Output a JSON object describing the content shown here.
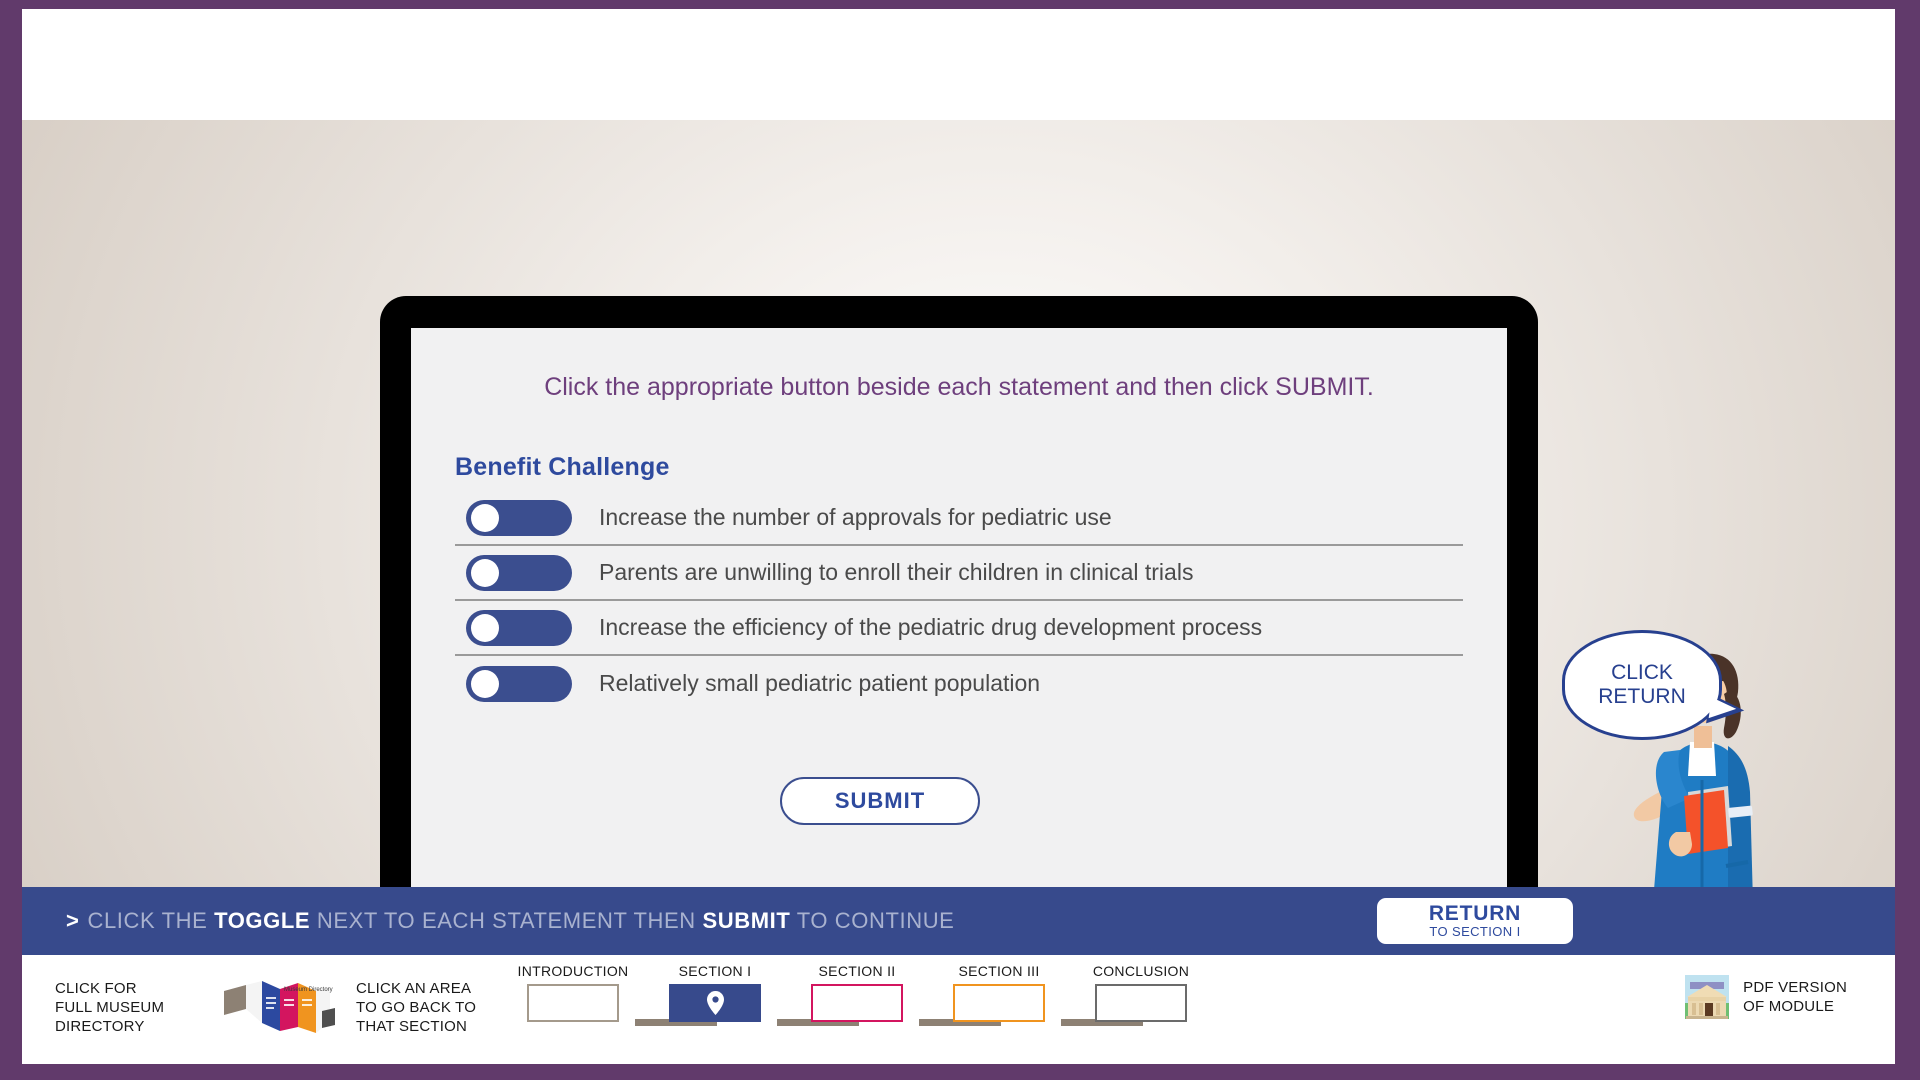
{
  "theme": {
    "frame_purple": "#613A6B",
    "bar_blue": "#374A8C",
    "toggle_blue": "#3B4E8F",
    "heading_blue": "#2E4A9E",
    "prompt_purple": "#6E3F7D",
    "scene_beige": "#B5A99D",
    "connector_brown": "#8D8174"
  },
  "screen": {
    "prompt": "Click the appropriate button beside each statement and then click SUBMIT.",
    "heading": "Benefit Challenge",
    "statements": [
      {
        "text": "Increase the number of approvals for pediatric use",
        "toggle_state": "left"
      },
      {
        "text": "Parents are unwilling to enroll their children in clinical trials",
        "toggle_state": "left"
      },
      {
        "text": "Increase the efficiency of the pediatric drug development process",
        "toggle_state": "left"
      },
      {
        "text": "Relatively small pediatric patient population",
        "toggle_state": "left"
      }
    ],
    "submit_label": "SUBMIT"
  },
  "presenter": {
    "bubble_line1": "CLICK",
    "bubble_line2": "RETURN"
  },
  "instruction_bar": {
    "chevron": ">",
    "part1": "CLICK THE ",
    "highlight1": "TOGGLE",
    "part2": " NEXT TO EACH STATEMENT THEN ",
    "highlight2": "SUBMIT",
    "part3": " TO CONTINUE",
    "return_button": {
      "line1": "RETURN",
      "line2": "TO SECTION I"
    }
  },
  "bottom_nav": {
    "museum_directory_label": "CLICK FOR\nFULL MUSEUM\nDIRECTORY",
    "brochure_icon_name": "museum-directory-brochure-icon",
    "click_area_label": "CLICK AN AREA\nTO GO BACK TO\nTHAT SECTION",
    "nodes": [
      {
        "caption": "INTRODUCTION",
        "border": "#a49a8c",
        "fill": "#ffffff",
        "current": false
      },
      {
        "caption": "SECTION I",
        "border": "#374a8c",
        "fill": "#374a8c",
        "current": true
      },
      {
        "caption": "SECTION II",
        "border": "#d81e5b",
        "fill": "#ffffff",
        "current": false
      },
      {
        "caption": "SECTION III",
        "border": "#f0941f",
        "fill": "#ffffff",
        "current": false
      },
      {
        "caption": "CONCLUSION",
        "border": "#6b6b6b",
        "fill": "#ffffff",
        "current": false
      }
    ],
    "pdf_label": "PDF VERSION\nOF MODULE",
    "pdf_icon_name": "museum-building-icon"
  }
}
